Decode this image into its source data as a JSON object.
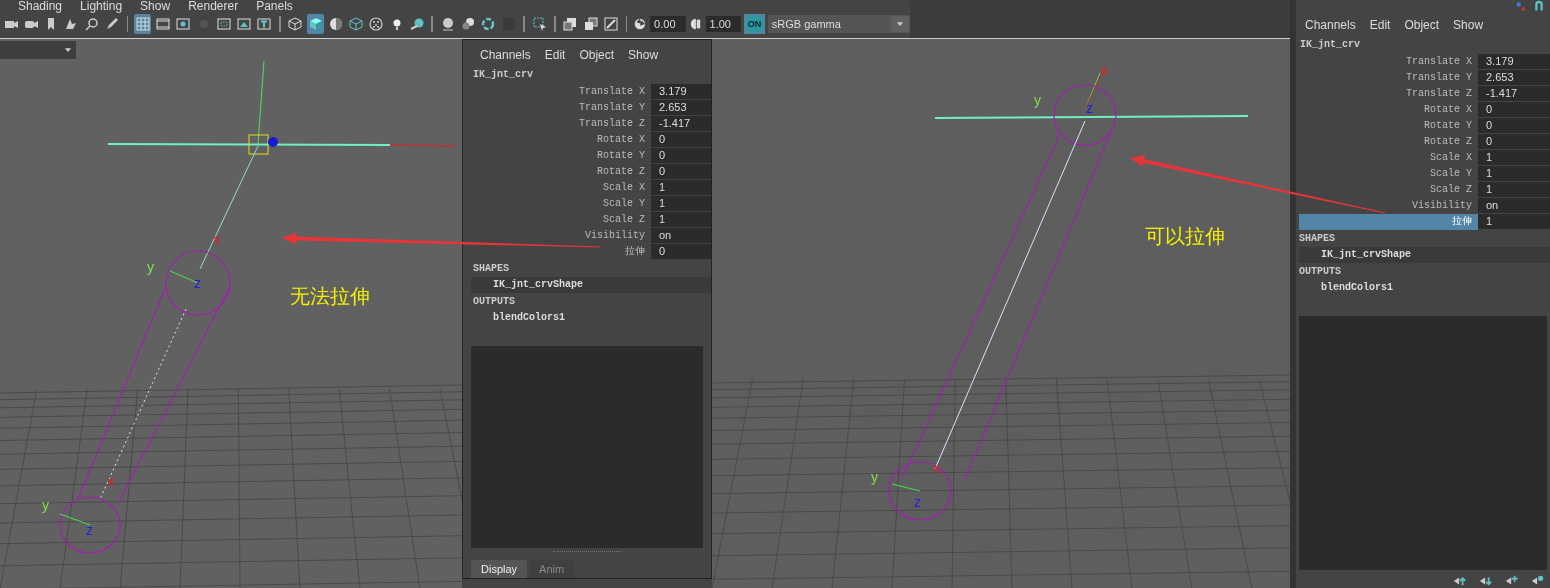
{
  "menu": [
    "Shading",
    "Lighting",
    "Show",
    "Renderer",
    "Panels"
  ],
  "toolbar": {
    "items": [
      {
        "kind": "button",
        "selected": false
      },
      {
        "kind": "button",
        "selected": false
      },
      {
        "kind": "button",
        "selected": false
      },
      {
        "kind": "button",
        "selected": false
      },
      {
        "kind": "button",
        "selected": false
      },
      {
        "kind": "button",
        "selected": false
      },
      {
        "kind": "separator"
      },
      {
        "kind": "button",
        "selected": true
      },
      {
        "kind": "button",
        "selected": false
      },
      {
        "kind": "button",
        "selected": false
      },
      {
        "kind": "button",
        "selected": false
      },
      {
        "kind": "button",
        "selected": false
      },
      {
        "kind": "button",
        "selected": false
      },
      {
        "kind": "button",
        "selected": false
      },
      {
        "kind": "separator"
      },
      {
        "kind": "button",
        "selected": false
      },
      {
        "kind": "button",
        "selected": true
      },
      {
        "kind": "button",
        "selected": false
      },
      {
        "kind": "button",
        "selected": false
      },
      {
        "kind": "button",
        "selected": false
      },
      {
        "kind": "button",
        "selected": false
      },
      {
        "kind": "button",
        "selected": false
      },
      {
        "kind": "separator"
      },
      {
        "kind": "button",
        "selected": false
      },
      {
        "kind": "button",
        "selected": false
      },
      {
        "kind": "button",
        "selected": false
      },
      {
        "kind": "button",
        "selected": false
      },
      {
        "kind": "separator"
      },
      {
        "kind": "button",
        "selected": false
      },
      {
        "kind": "separator"
      },
      {
        "kind": "button",
        "selected": false
      },
      {
        "kind": "button",
        "selected": false
      },
      {
        "kind": "button",
        "selected": false
      },
      {
        "kind": "separator"
      }
    ],
    "exposure": "0.00",
    "gamma": "1.00",
    "color_management": {
      "label": "ON",
      "on": true
    },
    "view_transform": "sRGB gamma"
  },
  "viewports": [
    {
      "annotation": "无法拉伸",
      "axis_labels": [
        {
          "text": "y",
          "color": "#7ee04a"
        },
        {
          "text": "z",
          "color": "#2020e0"
        },
        {
          "text": "x",
          "color": "#e02020"
        },
        {
          "text": "y",
          "color": "#7ee04a"
        },
        {
          "text": "z",
          "color": "#2020e0"
        },
        {
          "text": "x",
          "color": "#e02020"
        }
      ]
    },
    {
      "annotation": "可以拉伸",
      "axis_labels": [
        {
          "text": "y",
          "color": "#7ee04a"
        },
        {
          "text": "z",
          "color": "#2020e0"
        },
        {
          "text": "x",
          "color": "#e02020"
        },
        {
          "text": "y",
          "color": "#7ee04a"
        },
        {
          "text": "z",
          "color": "#2020e0"
        },
        {
          "text": "x",
          "color": "#e02020"
        }
      ]
    }
  ],
  "channel_boxes": [
    {
      "menus": [
        "Channels",
        "Edit",
        "Object",
        "Show"
      ],
      "object": "IK_jnt_crv",
      "attributes": [
        {
          "label": "Translate X",
          "value": "3.179",
          "selected": false
        },
        {
          "label": "Translate Y",
          "value": "2.653",
          "selected": false
        },
        {
          "label": "Translate Z",
          "value": "-1.417",
          "selected": false
        },
        {
          "label": "Rotate X",
          "value": "0",
          "selected": false
        },
        {
          "label": "Rotate Y",
          "value": "0",
          "selected": false
        },
        {
          "label": "Rotate Z",
          "value": "0",
          "selected": false
        },
        {
          "label": "Scale X",
          "value": "1",
          "selected": false
        },
        {
          "label": "Scale Y",
          "value": "1",
          "selected": false
        },
        {
          "label": "Scale Z",
          "value": "1",
          "selected": false
        },
        {
          "label": "Visibility",
          "value": "on",
          "selected": false
        },
        {
          "label": "拉伸",
          "value": "0",
          "selected": false
        }
      ],
      "sections": [
        {
          "header": "SHAPES",
          "items": [
            "IK_jnt_crvShape"
          ]
        },
        {
          "header": "OUTPUTS",
          "items": [
            "blendColors1"
          ]
        }
      ],
      "tabs": [
        {
          "label": "Display",
          "selected": true
        },
        {
          "label": "Anim",
          "selected": false
        }
      ]
    },
    {
      "menus": [
        "Channels",
        "Edit",
        "Object",
        "Show"
      ],
      "object": "IK_jnt_crv",
      "attributes": [
        {
          "label": "Translate X",
          "value": "3.179",
          "selected": false
        },
        {
          "label": "Translate Y",
          "value": "2.653",
          "selected": false
        },
        {
          "label": "Translate Z",
          "value": "-1.417",
          "selected": false
        },
        {
          "label": "Rotate X",
          "value": "0",
          "selected": false
        },
        {
          "label": "Rotate Y",
          "value": "0",
          "selected": false
        },
        {
          "label": "Rotate Z",
          "value": "0",
          "selected": false
        },
        {
          "label": "Scale X",
          "value": "1",
          "selected": false
        },
        {
          "label": "Scale Y",
          "value": "1",
          "selected": false
        },
        {
          "label": "Scale Z",
          "value": "1",
          "selected": false
        },
        {
          "label": "Visibility",
          "value": "on",
          "selected": false
        },
        {
          "label": "拉伸",
          "value": "1",
          "selected": true
        }
      ],
      "sections": [
        {
          "header": "SHAPES",
          "items": [
            "IK_jnt_crvShape"
          ]
        },
        {
          "header": "OUTPUTS",
          "items": [
            "blendColors1"
          ]
        }
      ]
    }
  ]
}
